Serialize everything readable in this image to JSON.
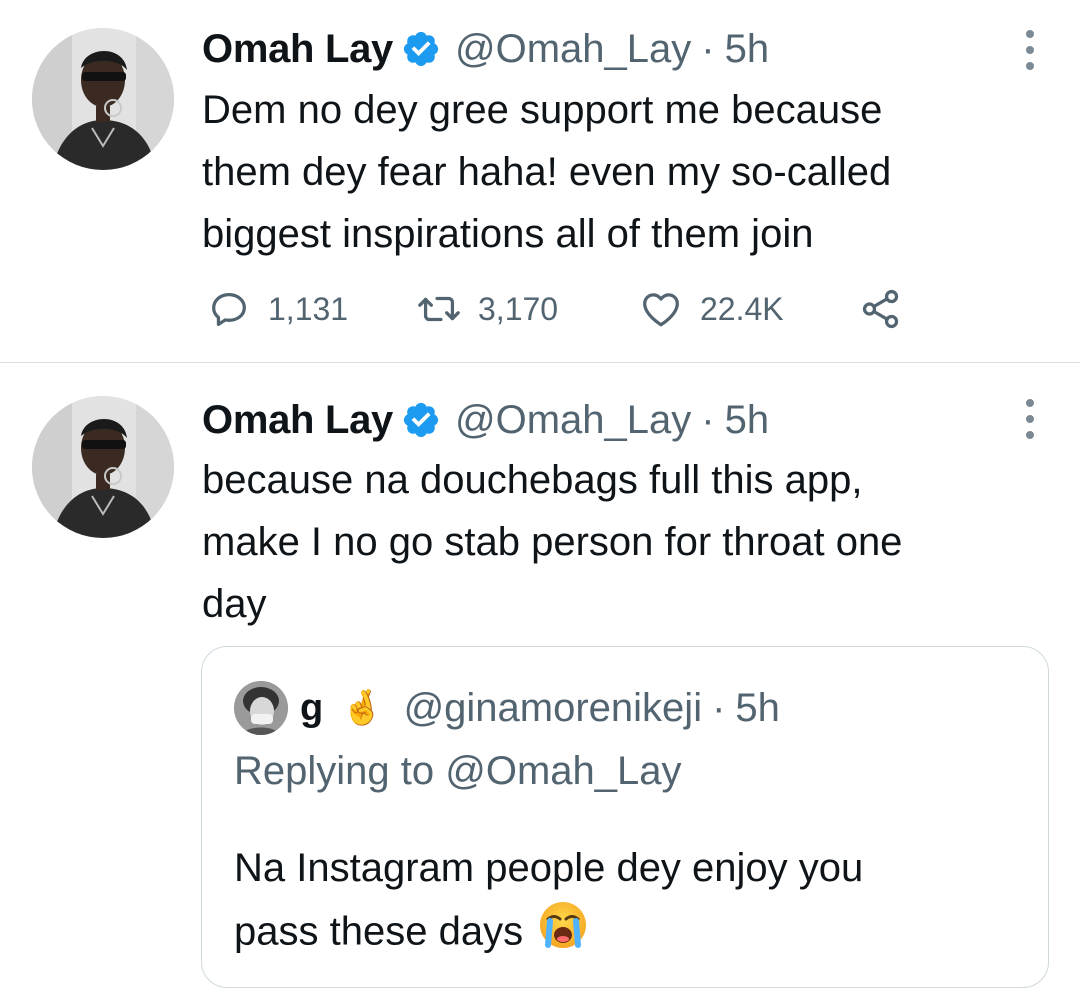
{
  "tweets": [
    {
      "author": {
        "name": "Omah Lay",
        "handle": "@Omah_Lay",
        "verified": true
      },
      "time": "5h",
      "text": "Dem no dey gree support me because\nthem dey fear haha! even my so-called\nbiggest inspirations all of them join",
      "stats": {
        "replies": "1,131",
        "retweets": "3,170",
        "likes": "22.4K"
      }
    },
    {
      "author": {
        "name": "Omah Lay",
        "handle": "@Omah_Lay",
        "verified": true
      },
      "time": "5h",
      "text": "because na douchebags full this app,\nmake I no go stab person for throat one\nday",
      "quoted": {
        "author": {
          "name": "g",
          "emoji": "🤞",
          "handle": "@ginamorenikeji"
        },
        "time": "5h",
        "replying_prefix": "Replying to ",
        "replying_to": "@Omah_Lay",
        "text": "Na Instagram people dey enjoy you\npass these days",
        "trailing_emoji": "loudly-crying-face"
      }
    }
  ],
  "separator": "·",
  "colors": {
    "verified": "#1d9bf0",
    "muted": "#536471",
    "text": "#0f1419",
    "border": "#cfd9de"
  }
}
